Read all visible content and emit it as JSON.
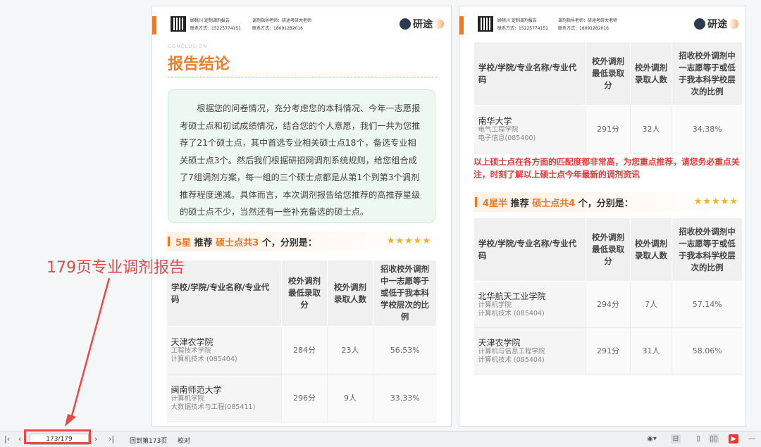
{
  "header": {
    "left_line1": "顾桃川 定制调剂报告",
    "left_line2": "联系方式：15225774151",
    "right_line1": "调剂指导老师：研途考研大老师",
    "right_line2": "联系方式：18091282016",
    "logo_text": "研途"
  },
  "left_page": {
    "conclusion_en": "CONCLUSION",
    "title": "报告结论",
    "summary": "根据您的问卷情况，充分考虑您的本科情况、今年一志愿报考硕士点和初试成绩情况，结合您的个人意愿，我们一共为您推荐了21个硕士点，其中首选专业相关硕士点18个，备选专业相关硕士点3个。然后我们根据研招网调剂系统规则，给您组合成了7组调剂方案，每一组的三个硕士点都是从第1个到第3个调剂推荐程度递减。具体而言，本次调剂报告给您推荐的高推荐星级的硕士点不少，当然还有一些补充备选的硕士点。",
    "rec_star": "5星",
    "rec_mid": "推荐",
    "rec_count": "硕士点共3",
    "rec_tail": "个，分别是：",
    "stars": "★★★★★",
    "table_headers": [
      "学校/学院/专业名称/专业代码",
      "校外调剂最低录取分",
      "校外调剂录取人数",
      "招收校外调剂中一志愿等于或低于我本科学校层次的比例"
    ],
    "rows": [
      {
        "school": "天津农学院",
        "college": "工程技术学院",
        "major": "计算机技术 (085404)",
        "score": "284分",
        "count": "23人",
        "ratio": "56.53%"
      },
      {
        "school": "闽南师范大学",
        "college": "计算机学院",
        "major": "大数据技术与工程(085411)",
        "score": "296分",
        "count": "9人",
        "ratio": "33.33%"
      }
    ]
  },
  "right_page": {
    "table_headers": [
      "学校/学院/专业名称/专业代码",
      "校外调剂最低录取分",
      "校外调剂录取人数",
      "招收校外调剂中一志愿等于或低于我本科学校层次的比例"
    ],
    "rows_top": [
      {
        "school": "南华大学",
        "college": "电气工程学院",
        "major": "电子信息(085400)",
        "score": "291分",
        "count": "32人",
        "ratio": "34.38%"
      }
    ],
    "note": "以上硕士点在各方面的匹配度都非常高，为您重点推荐，请您务必重点关注，时刻了解以上硕士点今年最新的调剂资讯",
    "rec_star": "4星半",
    "rec_mid": "推荐",
    "rec_count": "硕士点共4",
    "rec_tail": "个，分别是：",
    "stars": "★★★★★",
    "rows_bottom": [
      {
        "school": "北华航天工业学院",
        "college": "计算机学院",
        "major": "计算机技术 (085404)",
        "score": "294分",
        "count": "7人",
        "ratio": "57.14%"
      },
      {
        "school": "天津农学院",
        "college": "计算机与信息工程学院",
        "major": "计算机技术 (085404)",
        "score": "291分",
        "count": "31人",
        "ratio": "58.06%"
      }
    ]
  },
  "annotation": {
    "text": "179页专业调剂报告",
    "color": "#e84a4a"
  },
  "statusbar": {
    "page_value": "173/179",
    "back_label": "回到第173页",
    "proof_label": "校对"
  },
  "colors": {
    "accent": "#f07a23",
    "note_red": "#e73939",
    "summary_bg": "#eef8f2"
  }
}
